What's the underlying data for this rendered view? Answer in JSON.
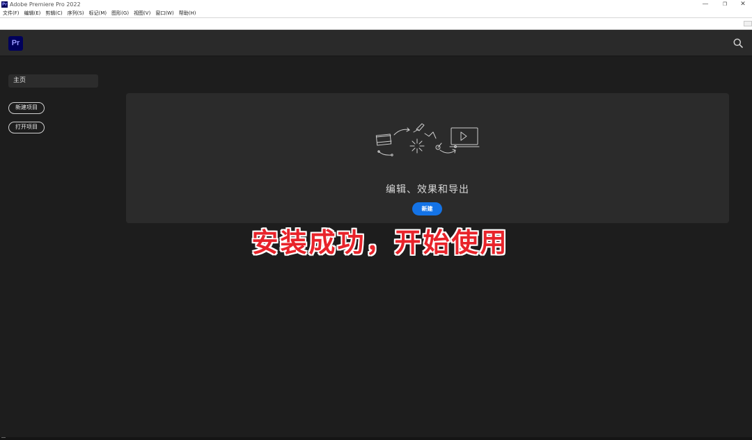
{
  "window": {
    "title": "Adobe Premiere Pro 2022",
    "app_icon_text": "Pr",
    "minimize": "—",
    "maximize": "❐",
    "close": "✕"
  },
  "menu": [
    {
      "label": "文件(F)"
    },
    {
      "label": "编辑(E)"
    },
    {
      "label": "剪辑(C)"
    },
    {
      "label": "序列(S)"
    },
    {
      "label": "标记(M)"
    },
    {
      "label": "图形(G)"
    },
    {
      "label": "视图(V)"
    },
    {
      "label": "窗口(W)"
    },
    {
      "label": "帮助(H)"
    }
  ],
  "header": {
    "logo_text": "Pr",
    "search_icon": "search-icon"
  },
  "sidebar": {
    "home_label": "主页",
    "new_project_label": "新建项目",
    "open_project_label": "打开项目"
  },
  "main_card": {
    "title": "编辑、效果和导出",
    "new_button_label": "新建"
  },
  "overlay_caption": "安装成功，开始使用",
  "colors": {
    "accent": "#1473e6",
    "pr_logo_bg": "#00005b",
    "pr_logo_fg": "#9999ff",
    "caption_red": "#e8232a",
    "background": "#1d1d1d",
    "card": "#2b2b2b"
  }
}
